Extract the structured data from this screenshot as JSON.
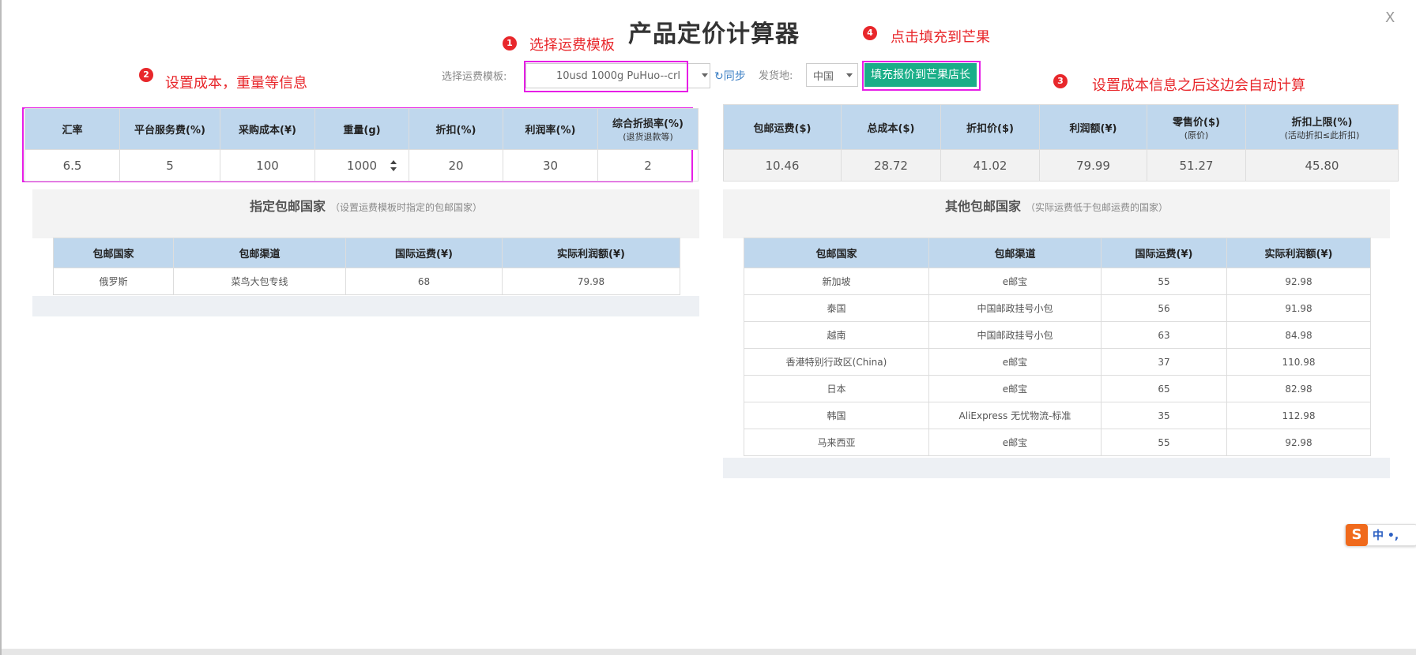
{
  "title": "产品定价计算器",
  "close_label": "X",
  "annotations": [
    {
      "num": "1",
      "text": "选择运费模板"
    },
    {
      "num": "2",
      "text": "设置成本，重量等信息"
    },
    {
      "num": "3",
      "text": "设置成本信息之后这边会自动计算"
    },
    {
      "num": "4",
      "text": "点击填充到芒果"
    }
  ],
  "toolbar": {
    "template_label": "选择运费模板:",
    "template_value": "10usd 1000g PuHuo--crl",
    "sync_label": "↻同步",
    "ship_from_label": "发货地:",
    "ship_from_value": "中国",
    "fill_button": "填充报价到芒果店长"
  },
  "input_table": {
    "headers": [
      "汇率",
      "平台服务费(%)",
      "采购成本(¥)",
      "重量(g)",
      "折扣(%)",
      "利润率(%)",
      "综合折损率(%)"
    ],
    "header_sub": "(退货退款等)",
    "values": [
      "6.5",
      "5",
      "100",
      "1000",
      "20",
      "30",
      "2"
    ]
  },
  "result_table": {
    "headers": [
      "包邮运费($)",
      "总成本($)",
      "折扣价($)",
      "利润额(¥)",
      "零售价($)",
      "折扣上限(%)"
    ],
    "header_subs": [
      "",
      "",
      "",
      "",
      "(原价)",
      "(活动折扣≤此折扣)"
    ],
    "values": [
      "10.46",
      "28.72",
      "41.02",
      "79.99",
      "51.27",
      "45.80"
    ]
  },
  "designated": {
    "title": "指定包邮国家",
    "note": "（设置运费模板时指定的包邮国家）",
    "headers": [
      "包邮国家",
      "包邮渠道",
      "国际运费(¥)",
      "实际利润额(¥)"
    ],
    "rows": [
      [
        "俄罗斯",
        "菜鸟大包专线",
        "68",
        "79.98"
      ]
    ]
  },
  "others": {
    "title": "其他包邮国家",
    "note": "（实际运费低于包邮运费的国家）",
    "headers": [
      "包邮国家",
      "包邮渠道",
      "国际运费(¥)",
      "实际利润额(¥)"
    ],
    "rows": [
      [
        "新加坡",
        "e邮宝",
        "55",
        "92.98"
      ],
      [
        "泰国",
        "中国邮政挂号小包",
        "56",
        "91.98"
      ],
      [
        "越南",
        "中国邮政挂号小包",
        "63",
        "84.98"
      ],
      [
        "香港特别行政区(China)",
        "e邮宝",
        "37",
        "110.98"
      ],
      [
        "日本",
        "e邮宝",
        "65",
        "82.98"
      ],
      [
        "韩国",
        "AliExpress 无忧物流-标准",
        "35",
        "112.98"
      ],
      [
        "马来西亚",
        "e邮宝",
        "55",
        "92.98"
      ]
    ]
  },
  "ime": {
    "logo": "S",
    "text": "中 •,"
  },
  "colors": {
    "accent_button": "#1aae88",
    "annotation": "#e8272b",
    "highlight": "#e61ee6",
    "header_bg": "#bfd7ed"
  }
}
